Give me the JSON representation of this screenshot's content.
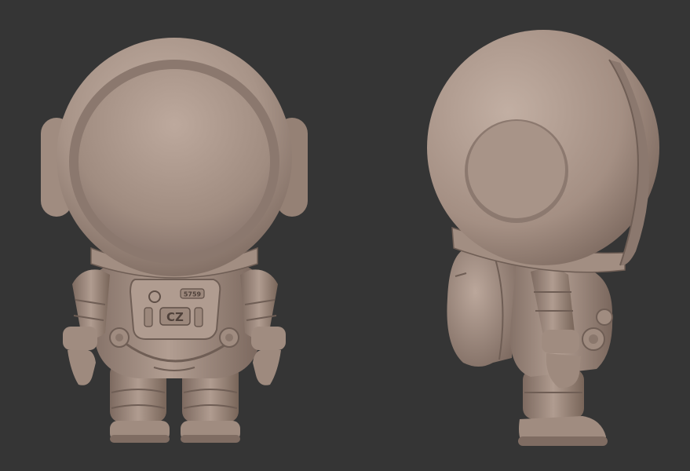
{
  "scene": {
    "background_color": "#353535",
    "clay_color": "#a69185",
    "clay_highlight": "#c9b6aa",
    "clay_shadow": "#6f5e55",
    "views": [
      "front",
      "side"
    ]
  },
  "front_view": {
    "chest_plate_label": "CZ",
    "chest_tag_number": "5759"
  }
}
